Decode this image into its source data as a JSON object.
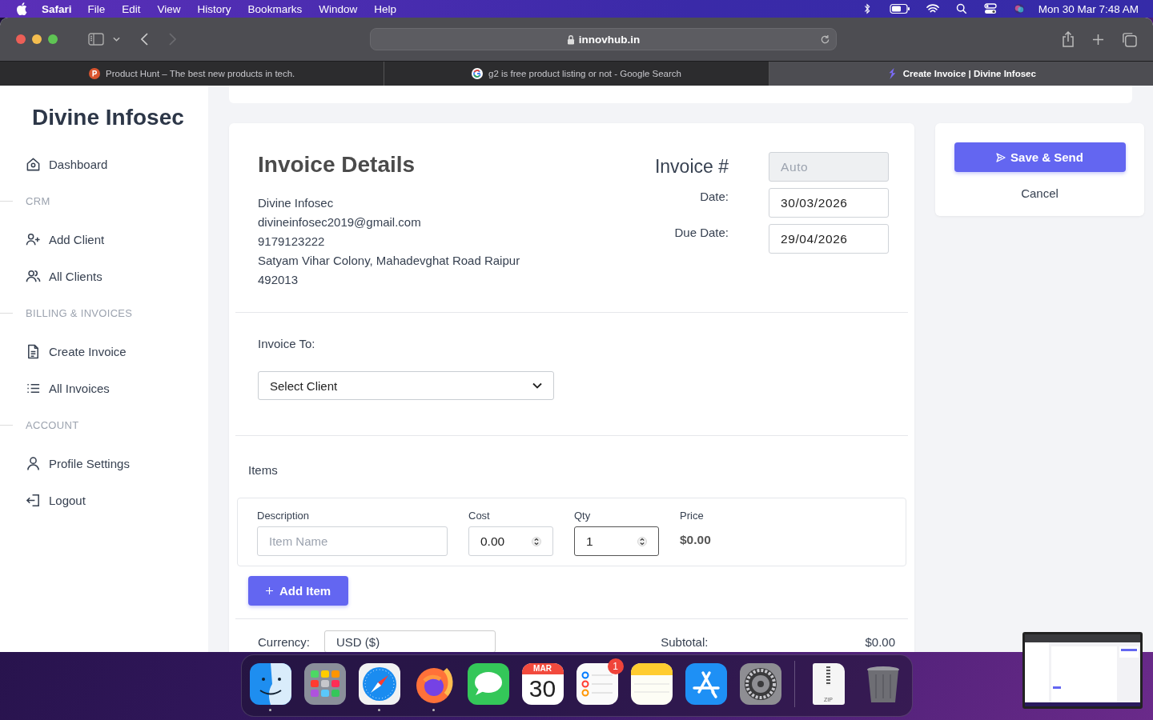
{
  "menubar": {
    "app": "Safari",
    "menus": [
      "File",
      "Edit",
      "View",
      "History",
      "Bookmarks",
      "Window",
      "Help"
    ],
    "clock": "Mon 30 Mar  7:48 AM"
  },
  "browser": {
    "url": "innovhub.in",
    "tabs": [
      {
        "title": "Product Hunt – The best new products in tech.",
        "selected": false,
        "kind": "producthunt"
      },
      {
        "title": "g2 is free product listing or not - Google Search",
        "selected": false,
        "kind": "google"
      },
      {
        "title": "Create Invoice | Divine Infosec",
        "selected": true,
        "kind": "site"
      }
    ]
  },
  "sidebar": {
    "brand": "Divine Infosec",
    "sections": [
      {
        "items": [
          {
            "label": "Dashboard",
            "kind": "home"
          }
        ]
      },
      {
        "heading": "CRM",
        "items": [
          {
            "label": "Add Client",
            "kind": "user-plus"
          },
          {
            "label": "All Clients",
            "kind": "users"
          }
        ]
      },
      {
        "heading": "BILLING & INVOICES",
        "items": [
          {
            "label": "Create Invoice",
            "kind": "document"
          },
          {
            "label": "All Invoices",
            "kind": "list"
          }
        ]
      },
      {
        "heading": "ACCOUNT",
        "items": [
          {
            "label": "Profile Settings",
            "kind": "user"
          },
          {
            "label": "Logout",
            "kind": "logout"
          }
        ]
      }
    ]
  },
  "invoice": {
    "title": "Invoice Details",
    "company": [
      "Divine Infosec",
      "divineinfosec2019@gmail.com",
      "9179123222",
      "Satyam Vihar Colony, Mahadevghat Road Raipur 492013"
    ],
    "number": {
      "label": "Invoice #",
      "placeholder": "Auto"
    },
    "date": {
      "label": "Date:",
      "value": "30/03/2026"
    },
    "due_date": {
      "label": "Due Date:",
      "value": "29/04/2026"
    },
    "invoice_to": {
      "label": "Invoice To:",
      "select": "Select Client"
    },
    "items": {
      "heading": "Items",
      "columns": [
        "Description",
        "Cost",
        "Qty",
        "Price"
      ],
      "row": {
        "description_placeholder": "Item Name",
        "cost": "0.00",
        "qty": "1",
        "qty_focused": true,
        "price": "$0.00"
      }
    },
    "add_item": "Add Item",
    "currency": {
      "label": "Currency:",
      "value": "USD ($)"
    },
    "subtotal": {
      "label": "Subtotal:",
      "value": "$0.00"
    }
  },
  "actions": {
    "save": "Save & Send",
    "cancel": "Cancel"
  },
  "dock": {
    "items": [
      {
        "kind": "finder",
        "running": true
      },
      {
        "kind": "launchpad",
        "running": false
      },
      {
        "kind": "safari",
        "running": true
      },
      {
        "kind": "firefox",
        "running": true
      },
      {
        "kind": "messages",
        "running": false
      },
      {
        "kind": "calendar",
        "running": false,
        "month": "MAR",
        "day": "30"
      },
      {
        "kind": "reminders",
        "running": false,
        "badge": "1"
      },
      {
        "kind": "notes",
        "running": false
      },
      {
        "kind": "appstore",
        "running": false
      },
      {
        "kind": "settings",
        "running": false
      }
    ],
    "extras": [
      {
        "kind": "zip",
        "label": "ZIP"
      },
      {
        "kind": "trash"
      }
    ]
  }
}
